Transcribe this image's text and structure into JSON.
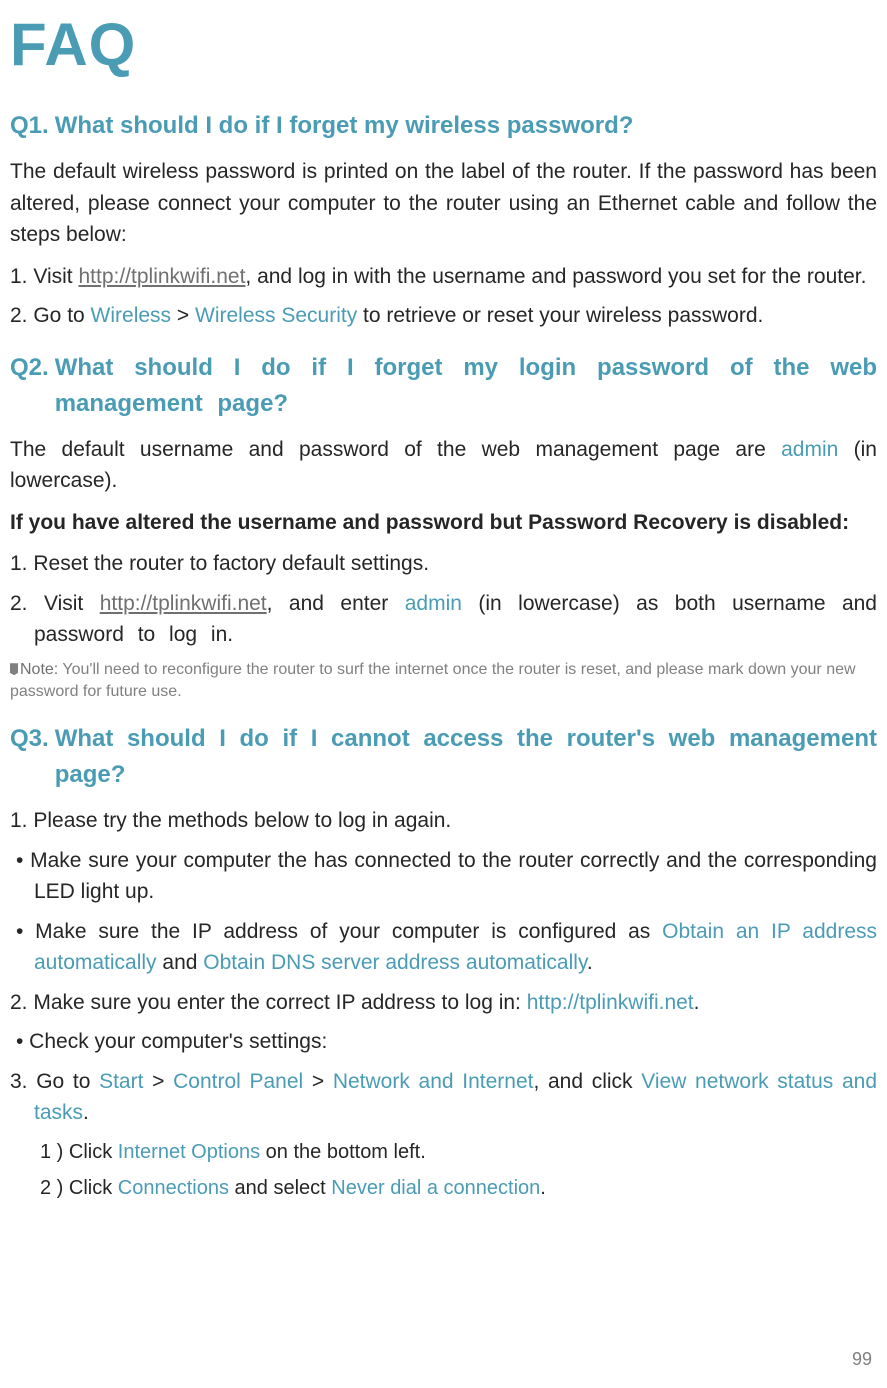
{
  "title": "FAQ",
  "page_number": "99",
  "q1": {
    "num": "Q1.",
    "heading": "What should I do if I forget my wireless password?",
    "intro": "The default wireless password is printed on the label of the router. If the password has been altered, please connect your computer to the router using an Ethernet cable and follow the steps below:",
    "step1_prefix": "1. Visit ",
    "step1_link": "http://tplinkwifi.net",
    "step1_suffix": ", and log in with the username and password you set for the router.",
    "step2_prefix": "2. Go to ",
    "step2_teal1": "Wireless",
    "step2_mid": " > ",
    "step2_teal2": "Wireless Security",
    "step2_suffix": " to retrieve or reset your wireless password."
  },
  "q2": {
    "num": "Q2.",
    "heading": "What should I do if I forget my login password of the web management page?",
    "intro_prefix": "The default username and password of the web management page are ",
    "intro_teal": "admin",
    "intro_suffix": " (in lowercase).",
    "bold_line": "If you have altered the username and password but Password Recovery is disabled:",
    "step1": "1. Reset the router to factory default settings.",
    "step2_prefix": "2. Visit ",
    "step2_link": "http://tplinkwifi.net",
    "step2_mid": ", and enter ",
    "step2_teal": "admin",
    "step2_suffix": " (in lowercase) as both username and password to log in.",
    "note_label": "Note:",
    "note_text": " You'll need to reconfigure the router to surf the internet once the router is reset, and please mark down your new password for future use."
  },
  "q3": {
    "num": "Q3.",
    "heading": "What should I do if I cannot access the router's web management page?",
    "step1": "1. Please try the methods below to log in again.",
    "bullet1": "•  Make sure your computer the has connected to the router correctly and the corresponding LED light up.",
    "bullet2_prefix": "•  Make sure the IP address of your computer is configured as ",
    "bullet2_teal1": "Obtain an IP address automatically",
    "bullet2_mid": " and ",
    "bullet2_teal2": "Obtain DNS server address automatically",
    "bullet2_suffix": ".",
    "step2_prefix": "2. Make sure  you enter the correct IP address to log in: ",
    "step2_teal": "http://tplinkwifi.net",
    "step2_suffix": ".",
    "bullet3": "•  Check your computer's settings:",
    "step3_prefix": "3. Go to ",
    "step3_teal1": "Start",
    "step3_gt1": " > ",
    "step3_teal2": "Control Panel",
    "step3_gt2": " > ",
    "step3_teal3": "Network and Internet",
    "step3_mid": ", and click ",
    "step3_teal4": "View network status and tasks",
    "step3_suffix": ".",
    "sub1_prefix": "1 )    Click ",
    "sub1_teal": "Internet Options",
    "sub1_suffix": " on the bottom left.",
    "sub2_prefix": "2 )    Click ",
    "sub2_teal1": "Connections",
    "sub2_mid": " and select ",
    "sub2_teal2": "Never dial a connection",
    "sub2_suffix": "."
  }
}
